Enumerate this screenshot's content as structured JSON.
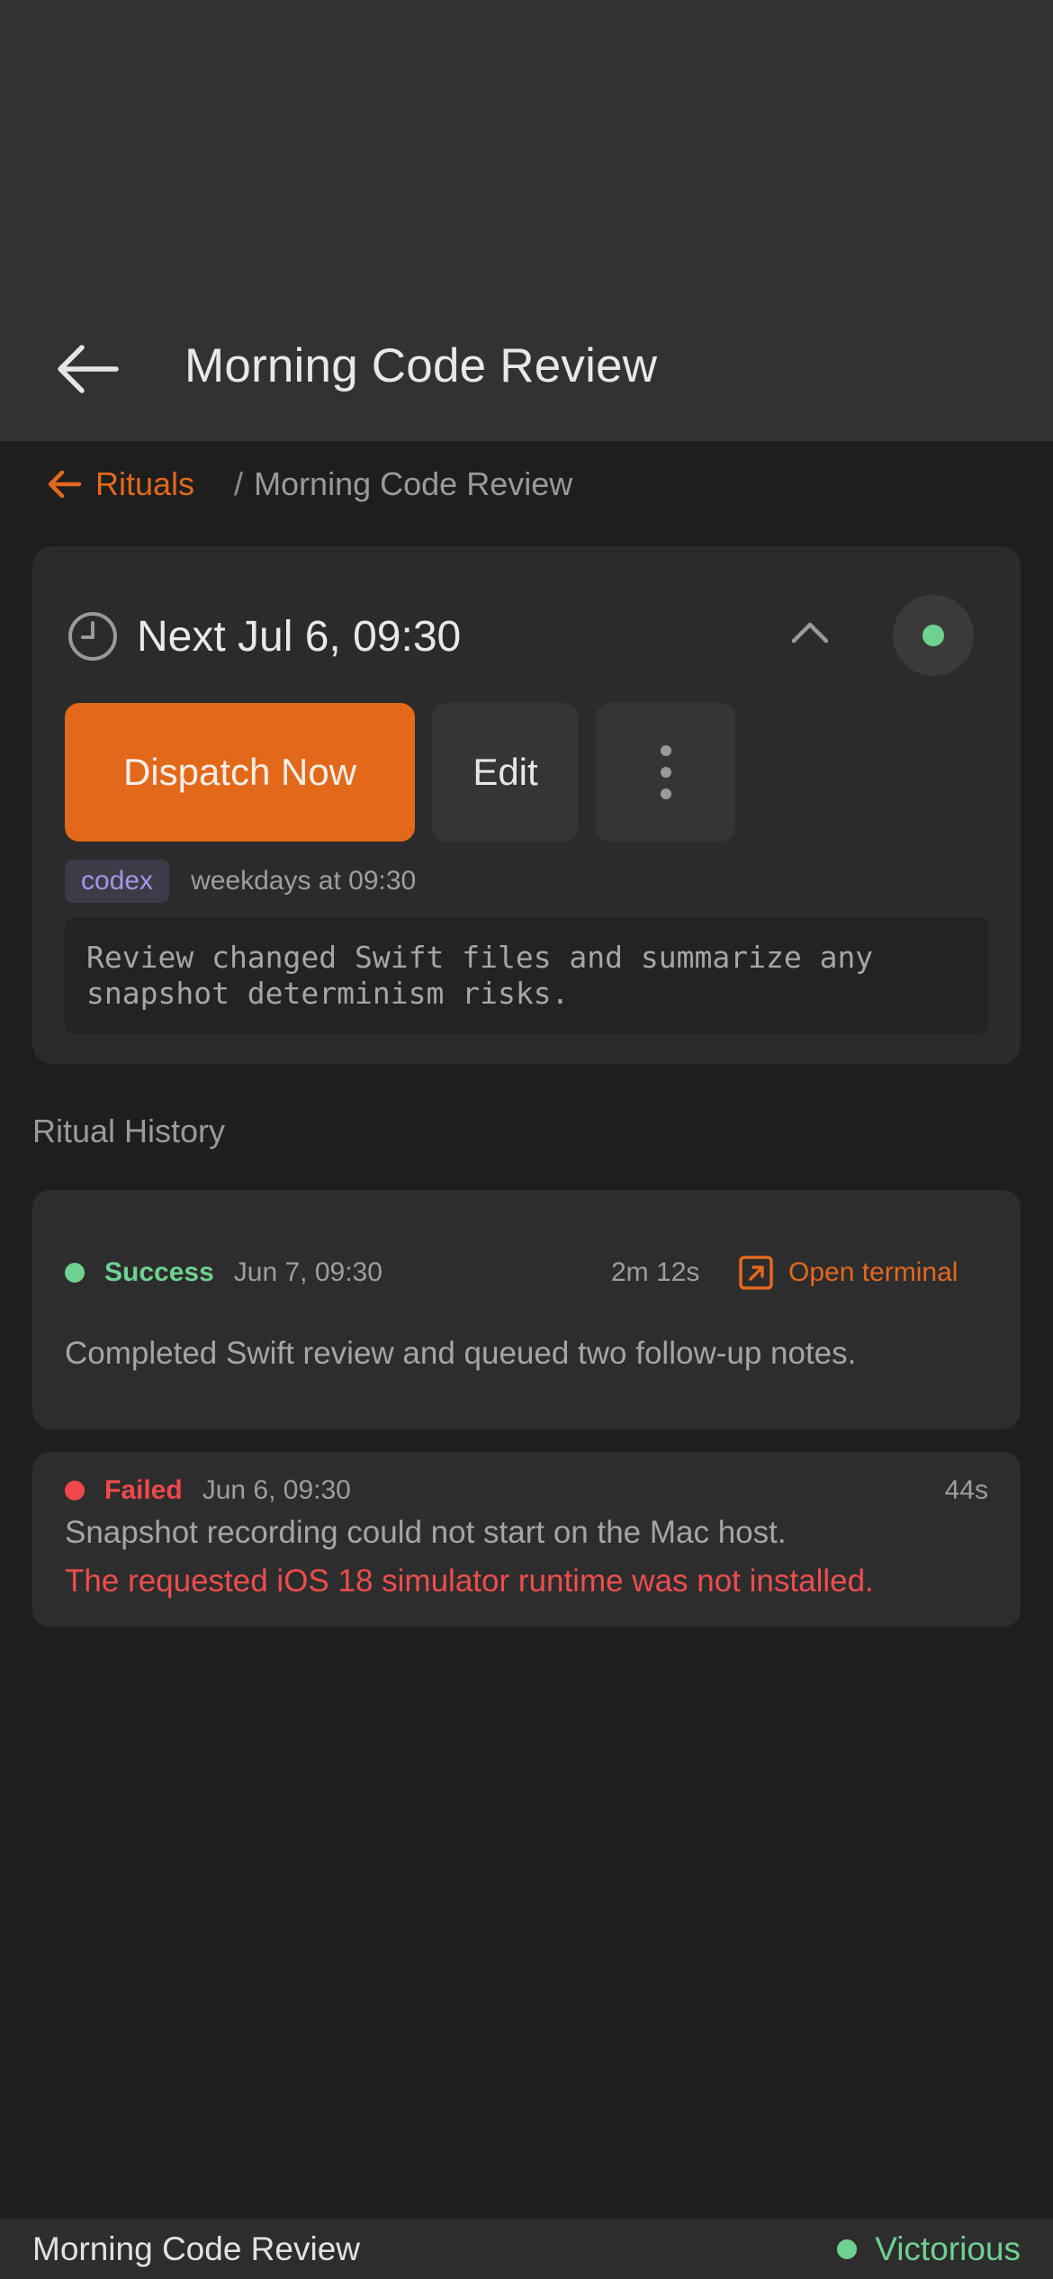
{
  "nav": {
    "title": "Morning Code Review",
    "back_icon": "arrow-left-icon"
  },
  "breadcrumb": {
    "parent": "Rituals",
    "separator": "/",
    "current": "Morning Code Review"
  },
  "ritual": {
    "next_run": "Next Jul 6, 09:30",
    "status": "active",
    "actions": {
      "dispatch": "Dispatch Now",
      "edit": "Edit"
    },
    "agent_tag": "codex",
    "schedule": "weekdays at 09:30",
    "prompt": "Review changed Swift files and summarize any\nsnapshot determinism risks."
  },
  "history": {
    "title": "Ritual History",
    "entries": [
      {
        "status": "Success",
        "date": "Jun 7, 09:30",
        "duration": "2m 12s",
        "action": "Open terminal",
        "summary": "Completed Swift review and queued two follow-up notes."
      },
      {
        "status": "Failed",
        "date": "Jun 6, 09:30",
        "duration": "44s",
        "summary": "Snapshot recording could not start on the Mac host.",
        "error": "The requested iOS 18 simulator runtime was not installed."
      }
    ]
  },
  "statusbar": {
    "title": "Morning Code Review",
    "state": "Victorious"
  },
  "colors": {
    "accent": "#e2681a",
    "success": "#6fd18f",
    "error": "#f0484a",
    "tag": "#a994e6"
  }
}
